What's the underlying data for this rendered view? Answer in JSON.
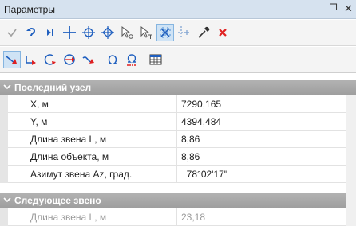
{
  "window": {
    "title": "Параметры",
    "pin_glyph": "❐",
    "close_glyph": "✕"
  },
  "toolbar_top": [
    {
      "icon": "check-icon",
      "label": "Применить"
    },
    {
      "icon": "undo-icon",
      "label": "Отменить"
    },
    {
      "icon": "next-icon",
      "label": "Следующий"
    },
    {
      "icon": "crosshair-icon",
      "label": "Перекрестие",
      "active": false
    },
    {
      "icon": "circle-cross-icon",
      "label": "Центр"
    },
    {
      "icon": "circle-cross-alt-icon",
      "label": "Центр 2"
    },
    {
      "icon": "pointer-o-icon",
      "label": "Указатель O"
    },
    {
      "icon": "pointer-t-icon",
      "label": "Указатель T"
    },
    {
      "icon": "snap-grid-icon",
      "label": "Привязка",
      "active": true
    },
    {
      "icon": "dotted-cross-icon",
      "label": "Пунктир"
    },
    {
      "icon": "pipette-icon",
      "label": "Пипетка"
    },
    {
      "icon": "delete-icon",
      "label": "Удалить"
    }
  ],
  "toolbar_bottom": [
    {
      "icon": "line-arrow-icon",
      "label": "Линия",
      "active": true
    },
    {
      "icon": "perpendicular-icon",
      "label": "Перпендикуляр"
    },
    {
      "icon": "arc-icon",
      "label": "Дуга"
    },
    {
      "icon": "circle-arrow-icon",
      "label": "Окружность"
    },
    {
      "icon": "curve-icon",
      "label": "Кривая"
    },
    {
      "icon": "omega-icon",
      "label": "Омега"
    },
    {
      "icon": "omega-settings-icon",
      "label": "Омега настройки"
    },
    {
      "icon": "table-icon",
      "label": "Таблица"
    }
  ],
  "sections": [
    {
      "title": "Последний узел",
      "rows": [
        {
          "name": "X, м",
          "value": "7290,165"
        },
        {
          "name": "Y, м",
          "value": "4394,484"
        },
        {
          "name": "Длина звена L, м",
          "value": "8,86"
        },
        {
          "name": "Длина объекта, м",
          "value": "8,86"
        },
        {
          "name": "Азимут звена Az, град.",
          "value": "  78°02'17\""
        }
      ]
    },
    {
      "title": "Следующее звено",
      "rows": [
        {
          "name": "Длина звена L, м",
          "value": "23,18"
        }
      ]
    }
  ],
  "colors": {
    "titlebar": "#d6e2ef",
    "category": "#a6a6a6",
    "accent_blue": "#1f5fbf",
    "delete_red": "#e02020"
  }
}
